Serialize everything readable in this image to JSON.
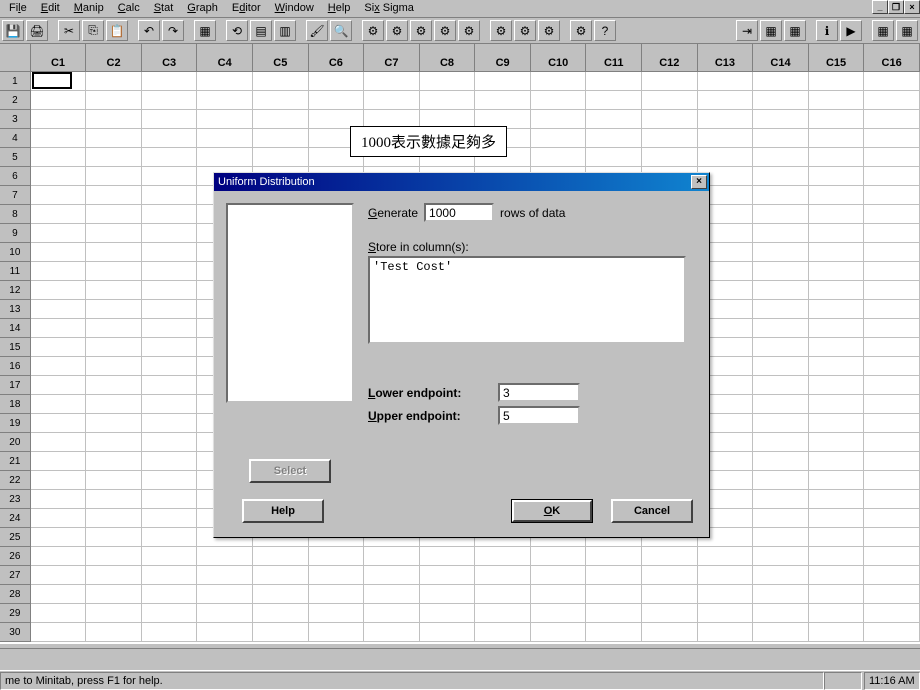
{
  "menu": {
    "items": [
      "File",
      "Edit",
      "Manip",
      "Calc",
      "Stat",
      "Graph",
      "Editor",
      "Window",
      "Help",
      "Six Sigma"
    ],
    "underline": [
      2,
      0,
      0,
      0,
      0,
      0,
      1,
      0,
      0,
      2
    ]
  },
  "columns": [
    "C1",
    "C2",
    "C3",
    "C4",
    "C5",
    "C6",
    "C7",
    "C8",
    "C9",
    "C10",
    "C11",
    "C12",
    "C13",
    "C14",
    "C15",
    "C16"
  ],
  "rows": [
    1,
    2,
    3,
    4,
    5,
    6,
    7,
    8,
    9,
    10,
    11,
    12,
    13,
    14,
    15,
    16,
    17,
    18,
    19,
    20,
    21,
    22,
    23,
    24,
    25,
    26,
    27,
    28,
    29,
    30
  ],
  "annotation": "1000表示數據足夠多",
  "dialog": {
    "title": "Uniform Distribution",
    "generate_label_pre": "Generate",
    "generate_value": "1000",
    "generate_label_post": "rows of data",
    "store_label": "Store in column(s):",
    "store_value": "'Test Cost'",
    "lower_label": "Lower endpoint:",
    "lower_value": "3",
    "upper_label": "Upper endpoint:",
    "upper_value": "5",
    "select_btn": "Select",
    "help_btn": "Help",
    "ok_btn": "OK",
    "cancel_btn": "Cancel"
  },
  "statusbar": {
    "message": "me to Minitab, press F1 for help.",
    "time": "11:16 AM"
  }
}
